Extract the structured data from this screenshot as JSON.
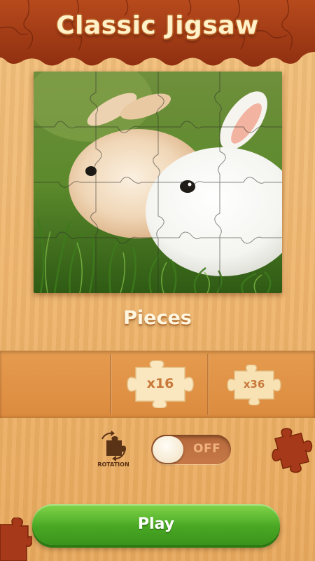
{
  "header": {
    "title": "Classic Jigsaw"
  },
  "puzzle": {
    "subject": "two bunnies on grass",
    "grid": "4x4"
  },
  "pieces": {
    "label": "Pieces",
    "options": [
      {
        "label": "",
        "selected": false
      },
      {
        "label": "x16",
        "selected": true
      },
      {
        "label": "x36",
        "selected": false
      }
    ]
  },
  "rotation": {
    "label": "ROTATION",
    "toggle_text": "OFF",
    "enabled": false
  },
  "actions": {
    "play_label": "Play"
  },
  "colors": {
    "wood": "#eeb46c",
    "puzzle_red": "#a13a16",
    "play_green": "#4aa724",
    "piece_cream": "#f9e3b5"
  }
}
